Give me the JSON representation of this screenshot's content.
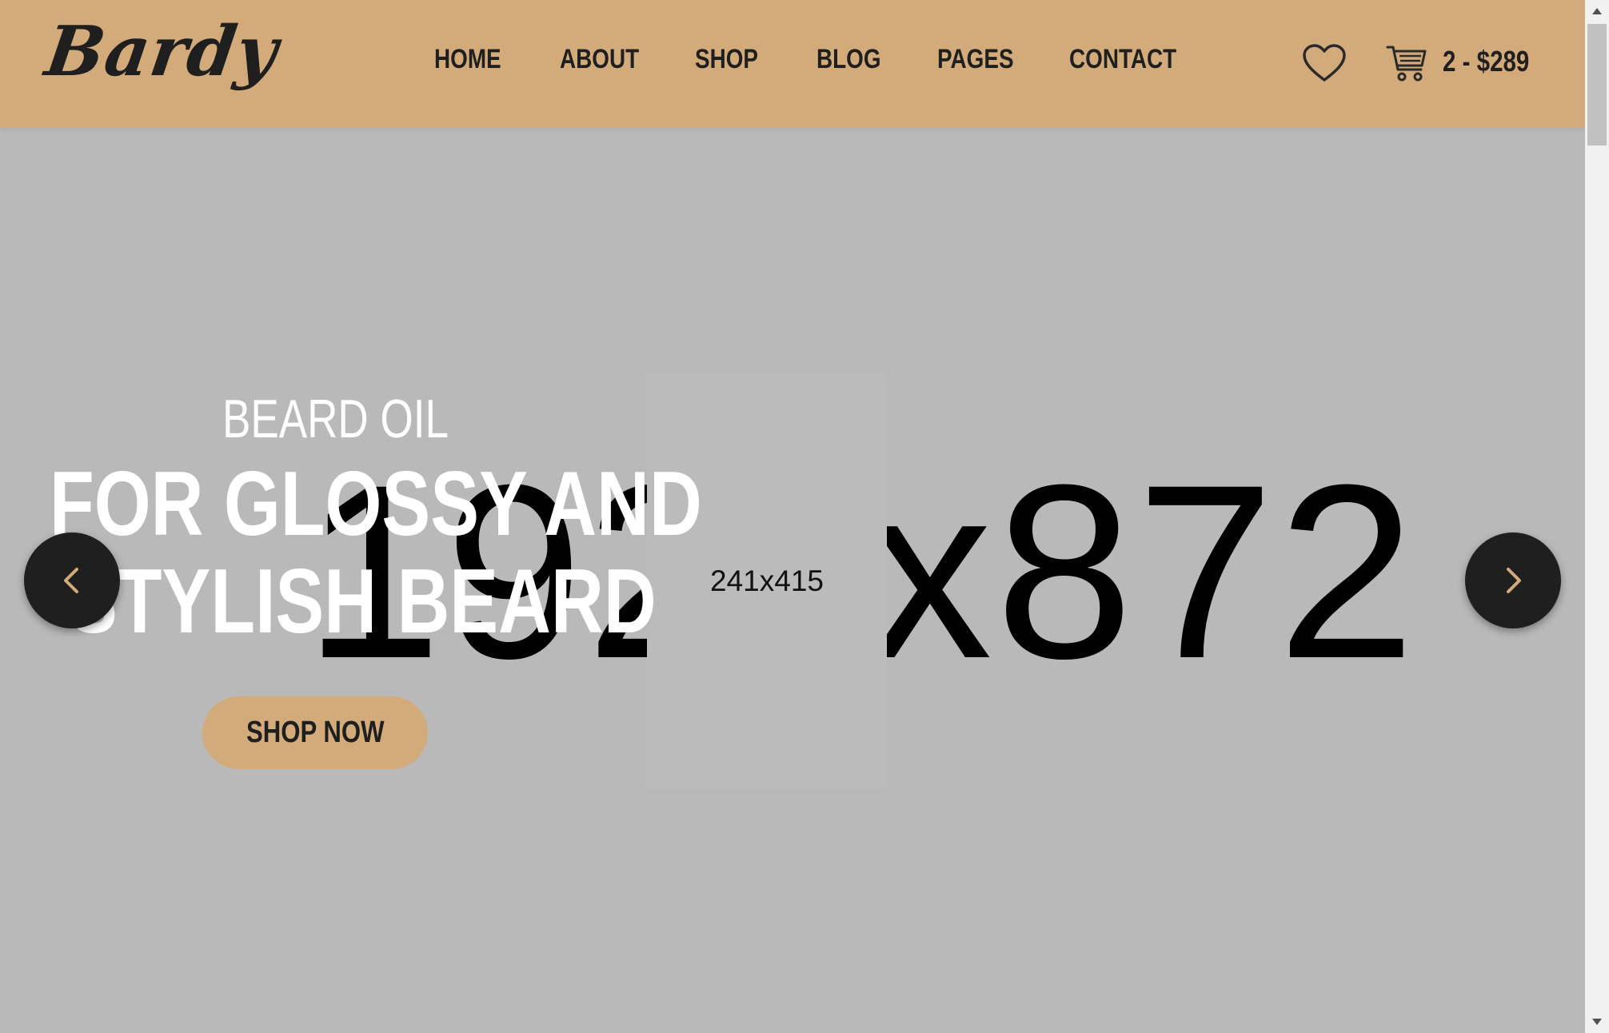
{
  "header": {
    "logo": "Bardy",
    "nav": {
      "home": "HOME",
      "about": "ABOUT",
      "shop": "SHOP",
      "blog": "BLOG",
      "pages": "PAGES",
      "contact": "CONTACT"
    },
    "wishlist_icon": "heart-icon",
    "cart_icon": "cart-icon",
    "cart_summary": "2 - $289"
  },
  "hero": {
    "background_placeholder": "1920x872",
    "product_placeholder": "241x415",
    "subtitle": "BEARD OIL",
    "title_line1": "FOR GLOSSY AND",
    "title_line2": "STYLISH BEARD",
    "cta_label": "SHOP NOW",
    "prev_icon": "chevron-left-icon",
    "next_icon": "chevron-right-icon"
  },
  "colors": {
    "header_bg": "#d3ab7a",
    "hero_bg": "#b9b9b9",
    "dark": "#1f1f1f",
    "accent": "#d3ab7a"
  }
}
